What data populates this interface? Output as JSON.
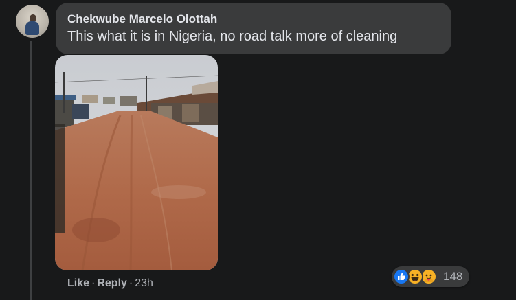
{
  "comment": {
    "author": "Chekwube Marcelo Olottah",
    "text": "This what it is in Nigeria, no road talk more of cleaning",
    "attachment_alt": "muddy road photo"
  },
  "actions": {
    "like_label": "Like",
    "separator": "·",
    "reply_label": "Reply",
    "time": "23h"
  },
  "reactions": {
    "icons": [
      "like-icon",
      "haha-icon",
      "care-icon"
    ],
    "count": "148"
  },
  "colors": {
    "background": "#18191a",
    "bubble": "#3a3b3c",
    "text_primary": "#e4e6eb",
    "text_secondary": "#b0b3b8",
    "like_blue": "#1877f2",
    "emoji_yellow": "#f7b125"
  }
}
